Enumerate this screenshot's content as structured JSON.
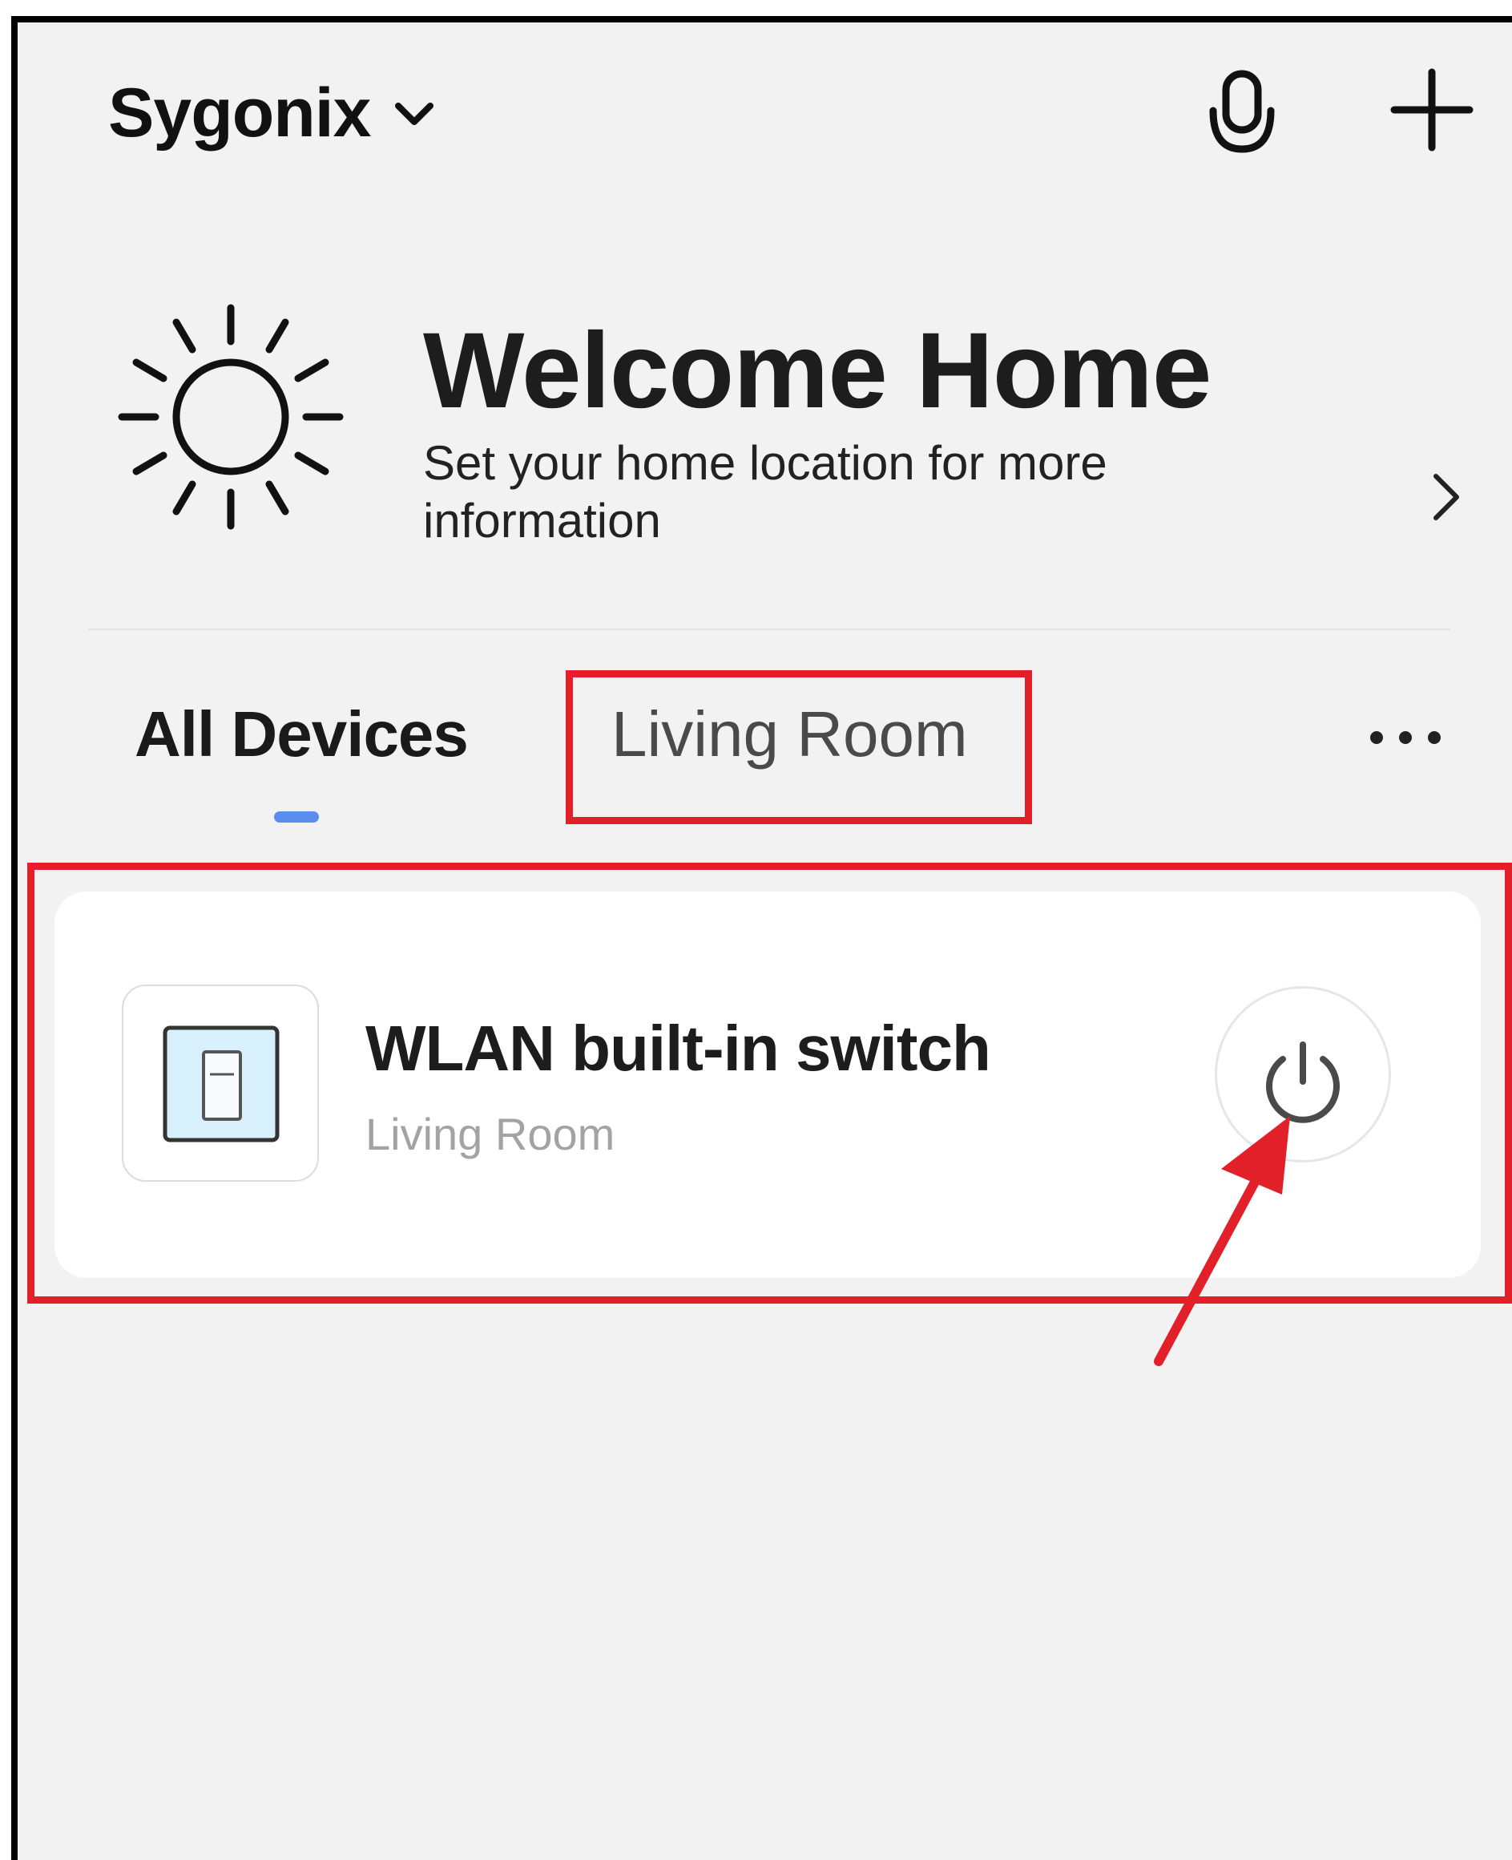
{
  "header": {
    "home_name": "Sygonix"
  },
  "welcome": {
    "title": "Welcome Home",
    "subtitle": "Set your home location for more information"
  },
  "tabs": [
    {
      "label": "All Devices",
      "active": true
    },
    {
      "label": "Living Room",
      "active": false
    }
  ],
  "devices": [
    {
      "name": "WLAN built-in switch",
      "room": "Living Room"
    }
  ],
  "colors": {
    "accent": "#5b8def",
    "highlight": "#e2202a",
    "background": "#f2f2f2"
  },
  "icons": [
    "chevron-down-icon",
    "microphone-icon",
    "plus-icon",
    "sun-icon",
    "chevron-right-icon",
    "more-icon",
    "wall-switch-icon",
    "power-icon"
  ]
}
